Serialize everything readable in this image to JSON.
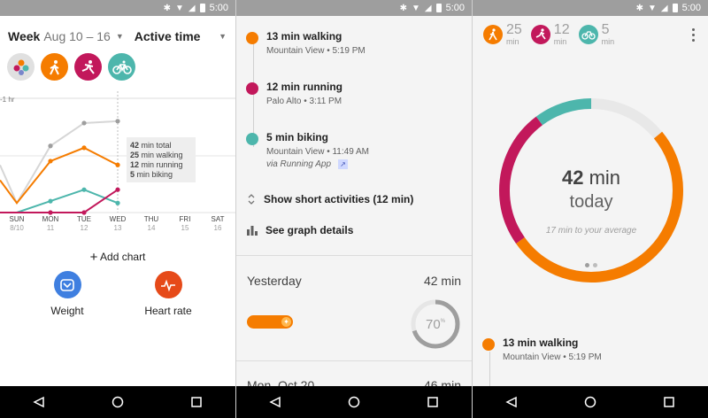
{
  "status": {
    "time": "5:00"
  },
  "colors": {
    "walking": "#f57c00",
    "running": "#c2185b",
    "biking": "#4db6ac",
    "accent": "#f57c00"
  },
  "panel1": {
    "period": "Week",
    "range": "Aug 10 – 16",
    "metric": "Active time",
    "filters": [
      "all-activities-icon",
      "walking-icon",
      "running-icon",
      "biking-icon"
    ],
    "chart_data": {
      "type": "line",
      "reference_line_label": "1 hr",
      "days": [
        {
          "dow": "SUN",
          "date": "8/10"
        },
        {
          "dow": "MON",
          "date": "11"
        },
        {
          "dow": "TUE",
          "date": "12"
        },
        {
          "dow": "WED",
          "date": "13"
        },
        {
          "dow": "THU",
          "date": "14"
        },
        {
          "dow": "FRI",
          "date": "15"
        },
        {
          "dow": "SAT",
          "date": "16"
        }
      ],
      "series": [
        {
          "name": "total",
          "values": [
            5,
            35,
            47,
            48
          ]
        },
        {
          "name": "walking",
          "values": [
            5,
            27,
            34,
            25
          ]
        },
        {
          "name": "running",
          "values": [
            0,
            0,
            0,
            12
          ]
        },
        {
          "name": "biking",
          "values": [
            0,
            6,
            12,
            5
          ]
        }
      ],
      "tooltip": [
        {
          "value": "42",
          "label": "min total"
        },
        {
          "value": "25",
          "label": "min walking"
        },
        {
          "value": "12",
          "label": "min running"
        },
        {
          "value": "5",
          "label": "min biking"
        }
      ]
    },
    "add_chart": "Add chart",
    "cards": [
      {
        "label": "Weight",
        "icon": "scale-icon"
      },
      {
        "label": "Heart rate",
        "icon": "heartbeat-icon"
      }
    ]
  },
  "panel2": {
    "activities": [
      {
        "title": "13 min walking",
        "place": "Mountain View • 5:19 PM"
      },
      {
        "title": "12 min running",
        "place": "Palo Alto • 3:11 PM"
      },
      {
        "title": "5 min biking",
        "place": "Mountain View • 11:49 AM",
        "via": "via Running App"
      }
    ],
    "show_short": "Show short activities (12 min)",
    "graph_details": "See graph details",
    "yesterday": {
      "label": "Yesterday",
      "value": "42 min",
      "goal_pct": "70",
      "goal_fraction": 0.7
    },
    "next_day": {
      "label": "Mon, Oct 20",
      "value": "46 min"
    }
  },
  "panel3": {
    "stats": [
      {
        "value": "25",
        "unit": "min",
        "icon": "walking-icon"
      },
      {
        "value": "12",
        "unit": "min",
        "icon": "running-icon"
      },
      {
        "value": "5",
        "unit": "min",
        "icon": "biking-icon"
      }
    ],
    "total_value": "42",
    "total_unit": "min",
    "today": "today",
    "average_note": "17 min to your average",
    "activity": {
      "title": "13 min walking",
      "place": "Mountain View • 5:19 PM"
    }
  }
}
